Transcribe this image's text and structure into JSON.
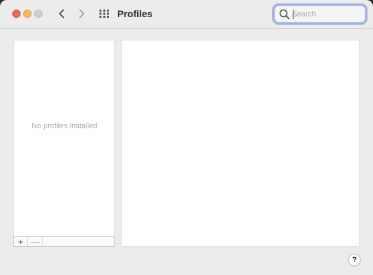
{
  "window": {
    "title": "Profiles"
  },
  "toolbar": {
    "back_icon": "chevron-left-icon",
    "forward_icon": "chevron-right-icon",
    "grid_icon": "grid-icon"
  },
  "search": {
    "placeholder": "Search",
    "value": "",
    "icon": "search-icon"
  },
  "profiles_list": {
    "empty_message": "No profiles installed",
    "add_label": "+",
    "remove_label": "—"
  },
  "help": {
    "label": "?"
  },
  "colors": {
    "close": "#ed6a5e",
    "minimize": "#f5bf4f",
    "zoom": "#cfcfcf",
    "focus_ring": "#9fb4e2"
  }
}
